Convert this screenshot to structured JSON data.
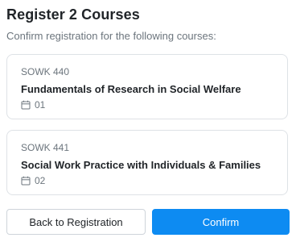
{
  "dialog": {
    "title": "Register 2 Courses",
    "subtitle": "Confirm registration for the following courses:"
  },
  "courses": [
    {
      "code": "SOWK 440",
      "name": "Fundamentals of Research in Social Welfare",
      "section": "01",
      "icon": "calendar-icon"
    },
    {
      "code": "SOWK 441",
      "name": "Social Work Practice with Individuals & Families",
      "section": "02",
      "icon": "calendar-icon"
    }
  ],
  "actions": {
    "back_label": "Back to Registration",
    "confirm_label": "Confirm"
  },
  "colors": {
    "primary": "#0d8bf2",
    "border": "#dee2e6",
    "muted_text": "#6c757d",
    "text": "#212529"
  }
}
